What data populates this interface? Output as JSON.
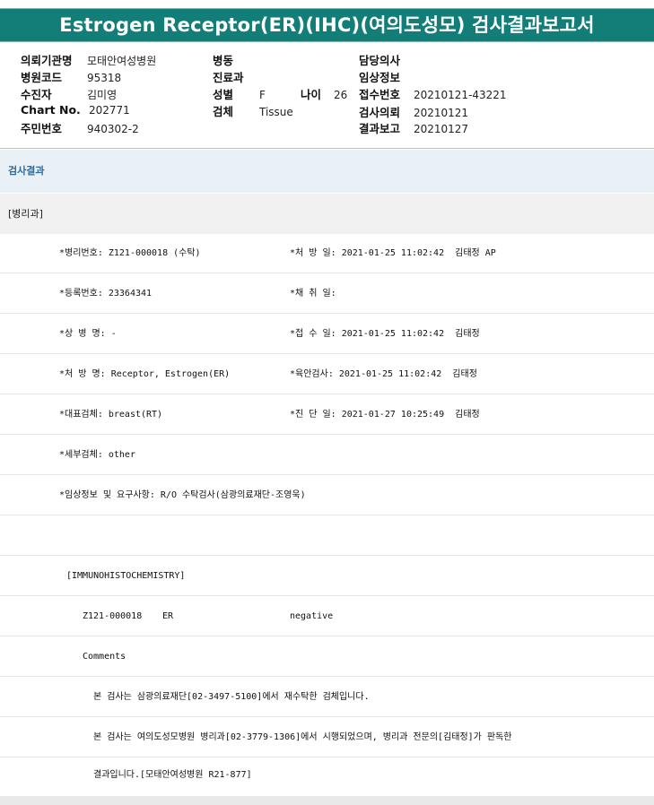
{
  "title": "Estrogen Receptor(ER)(IHC)(여의도성모) 검사결과보고서",
  "header": {
    "institution_label": "의뢰기관명",
    "institution_value": "모태안여성병원",
    "hospital_code_label": "병원코드",
    "hospital_code_value": "95318",
    "patient_label": "수진자",
    "patient_value": "김미영",
    "chart_label": "Chart No.",
    "chart_value": "202771",
    "resident_label": "주민번호",
    "resident_value": "940302-2",
    "ward_label": "병동",
    "dept_label": "진료과",
    "sex_label": "성별",
    "sex_value": "F",
    "age_label": "나이",
    "age_value": "26",
    "specimen_label": "검체",
    "specimen_value": "Tissue",
    "doctor_label": "담당의사",
    "clinical_label": "임상정보",
    "receipt_label": "접수번호",
    "receipt_value": "20210121-43221",
    "request_label": "검사의뢰",
    "request_value": "20210121",
    "report_label": "결과보고",
    "report_value": "20210127"
  },
  "results_section": "검사결과",
  "pathology_section": "[병리과]",
  "rows": [
    {
      "left": "*병리번호: Z121-000018 (수탁)",
      "right": "*처 방 일: 2021-01-25 11:02:42  김태정 AP"
    },
    {
      "left": "*등록번호: 23364341",
      "right": "*채 취 일:"
    },
    {
      "left": "*상 병 명: -",
      "right": "*접 수 일: 2021-01-25 11:02:42  김태정"
    },
    {
      "left": "*처 방 명: Receptor, Estrogen(ER)",
      "right": "*육안검사: 2021-01-25 11:02:42  김태정"
    },
    {
      "left": "*대표검체: breast(RT)",
      "right": "*진 단 일: 2021-01-27 10:25:49  김태정"
    },
    {
      "left": "*세부검체: other",
      "right": ""
    },
    {
      "left": "*임상정보 및 요구사항: R/O 수탁검사(삼광의료재단-조영욱)",
      "right": ""
    }
  ],
  "ihc": {
    "heading": "[IMMUNOHISTOCHEMISTRY]",
    "case_no": "Z121-000018",
    "marker": "ER",
    "result": "negative",
    "comments_label": "Comments",
    "comment_1": "본 검사는 삼광의료재단[02-3497-5100]에서 재수탁한 검체입니다.",
    "comment_2": "본 검사는 여의도성모병원 병리과[02-3779-1306]에서 시행되었으며, 병리과 전문의[김태정]가 판독한",
    "comment_3": "결과입니다.[모태안여성병원 R21-877]"
  }
}
